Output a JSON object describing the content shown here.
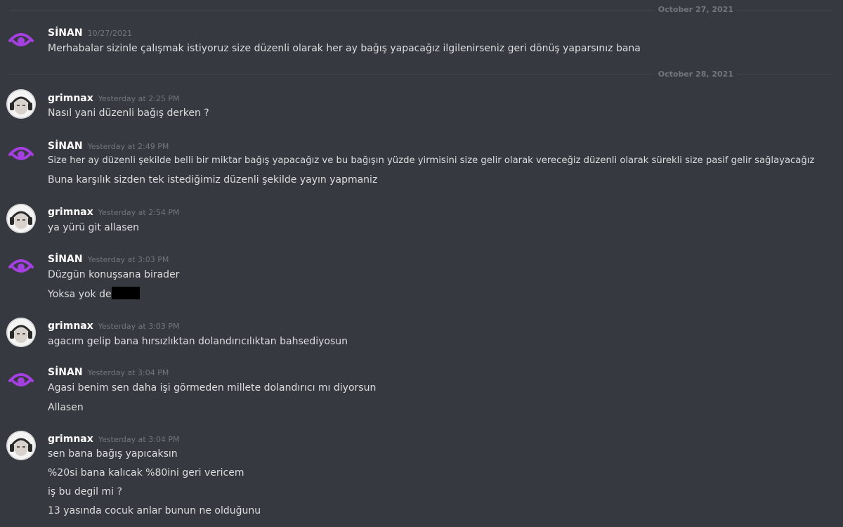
{
  "dividers": [
    "October 27, 2021",
    "October 28, 2021"
  ],
  "users": {
    "sinan": {
      "name": "SİNAN",
      "avatar": "purple-eye-logo-icon",
      "accent": "#a43fe0"
    },
    "grimnax": {
      "name": "grimnax",
      "avatar": "headphones-avatar-icon"
    }
  },
  "messages": [
    {
      "author": "SİNAN",
      "time": "10/27/2021",
      "lines": [
        "Merhabalar sizinle çalışmak istiyoruz size düzenli olarak her ay bağış yapacağız ilgilenirseniz geri dönüş yaparsınız bana"
      ]
    },
    {
      "author": "grimnax",
      "time": "Yesterday at 2:25 PM",
      "lines": [
        "Nasıl yani düzenli bağış derken ?"
      ]
    },
    {
      "author": "SİNAN",
      "time": "Yesterday at 2:49 PM",
      "lines": [
        "Size her ay düzenli şekilde belli bir miktar bağış yapacağız ve bu bağışın yüzde yirmisini size gelir olarak vereceğiz düzenli olarak sürekli size pasif gelir sağlayacağız",
        "Buna karşılık sizden tek istediğimiz düzenli şekilde yayın yapmaniz"
      ]
    },
    {
      "author": "grimnax",
      "time": "Yesterday at 2:54 PM",
      "lines": [
        "ya yürü git allasen"
      ]
    },
    {
      "author": "SİNAN",
      "time": "Yesterday at 3:03 PM",
      "lines": [
        "Düzgün konuşsana birader",
        "Yoksa yok de"
      ]
    },
    {
      "author": "grimnax",
      "time": "Yesterday at 3:03 PM",
      "lines": [
        "agacım gelip bana hırsızlıktan dolandırıcılıktan bahsediyosun"
      ]
    },
    {
      "author": "SİNAN",
      "time": "Yesterday at 3:04 PM",
      "lines": [
        "Agasi benim sen daha işi görmeden millete dolandırıcı mı diyorsun",
        "Allasen"
      ]
    },
    {
      "author": "grimnax",
      "time": "Yesterday at 3:04 PM",
      "lines": [
        "sen bana bağış yapıcaksın",
        "%20si bana kalıcak %80ini geri vericem",
        "iş bu degil mi ?",
        "13 yasında cocuk anlar bunun ne olduğunu"
      ]
    }
  ]
}
